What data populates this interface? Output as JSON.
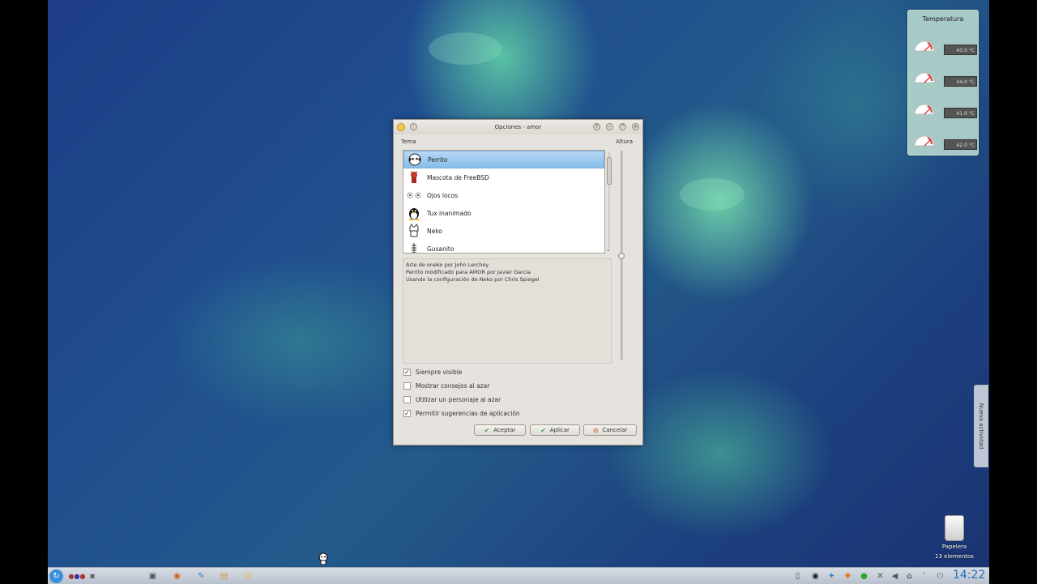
{
  "desktop": {
    "wallpaper": "mint leaves",
    "temperature_widget": {
      "title": "Temperatura",
      "sensors": [
        {
          "value": "43.0 °C"
        },
        {
          "value": "44.0 °C"
        },
        {
          "value": "41.0 °C"
        },
        {
          "value": "42.0 °C"
        }
      ]
    },
    "activity_tab": "Nueva actividad",
    "trash": {
      "label": "Papelera",
      "count": "13 elementos"
    }
  },
  "dialog": {
    "title": "Opciones - amor",
    "theme_label": "Tema",
    "height_label": "Altura",
    "themes": [
      {
        "name": "Perrito",
        "icon": "dog-icon",
        "selected": true
      },
      {
        "name": "Mascota de FreeBSD",
        "icon": "daemon-icon",
        "selected": false
      },
      {
        "name": "Ojos locos",
        "icon": "eyes-icon",
        "selected": false
      },
      {
        "name": "Tux inanimado",
        "icon": "tux-icon",
        "selected": false
      },
      {
        "name": "Neko",
        "icon": "cat-icon",
        "selected": false
      },
      {
        "name": "Gusanito",
        "icon": "worm-icon",
        "selected": false
      }
    ],
    "about_lines": [
      "Arte de oneko por John Lerchey",
      "Perrito modificado para AMOR por Javier Garcia",
      "Usando la configuración de Neko por Chris Spiegel"
    ],
    "options": [
      {
        "label": "Siempre visible",
        "checked": true
      },
      {
        "label": "Mostrar consejos al azar",
        "checked": false
      },
      {
        "label": "Utilizar un personaje al azar",
        "checked": false
      },
      {
        "label": "Permitir sugerencias de aplicación",
        "checked": true
      }
    ],
    "buttons": {
      "ok": "Aceptar",
      "apply": "Aplicar",
      "cancel": "Cancelar"
    }
  },
  "taskbar": {
    "clock": "14:22"
  },
  "colors": {
    "selection": "#87bde9",
    "clock": "#2b6db8",
    "cancel_icon": "#d23a2a",
    "ok_icon": "#4aa04a"
  }
}
